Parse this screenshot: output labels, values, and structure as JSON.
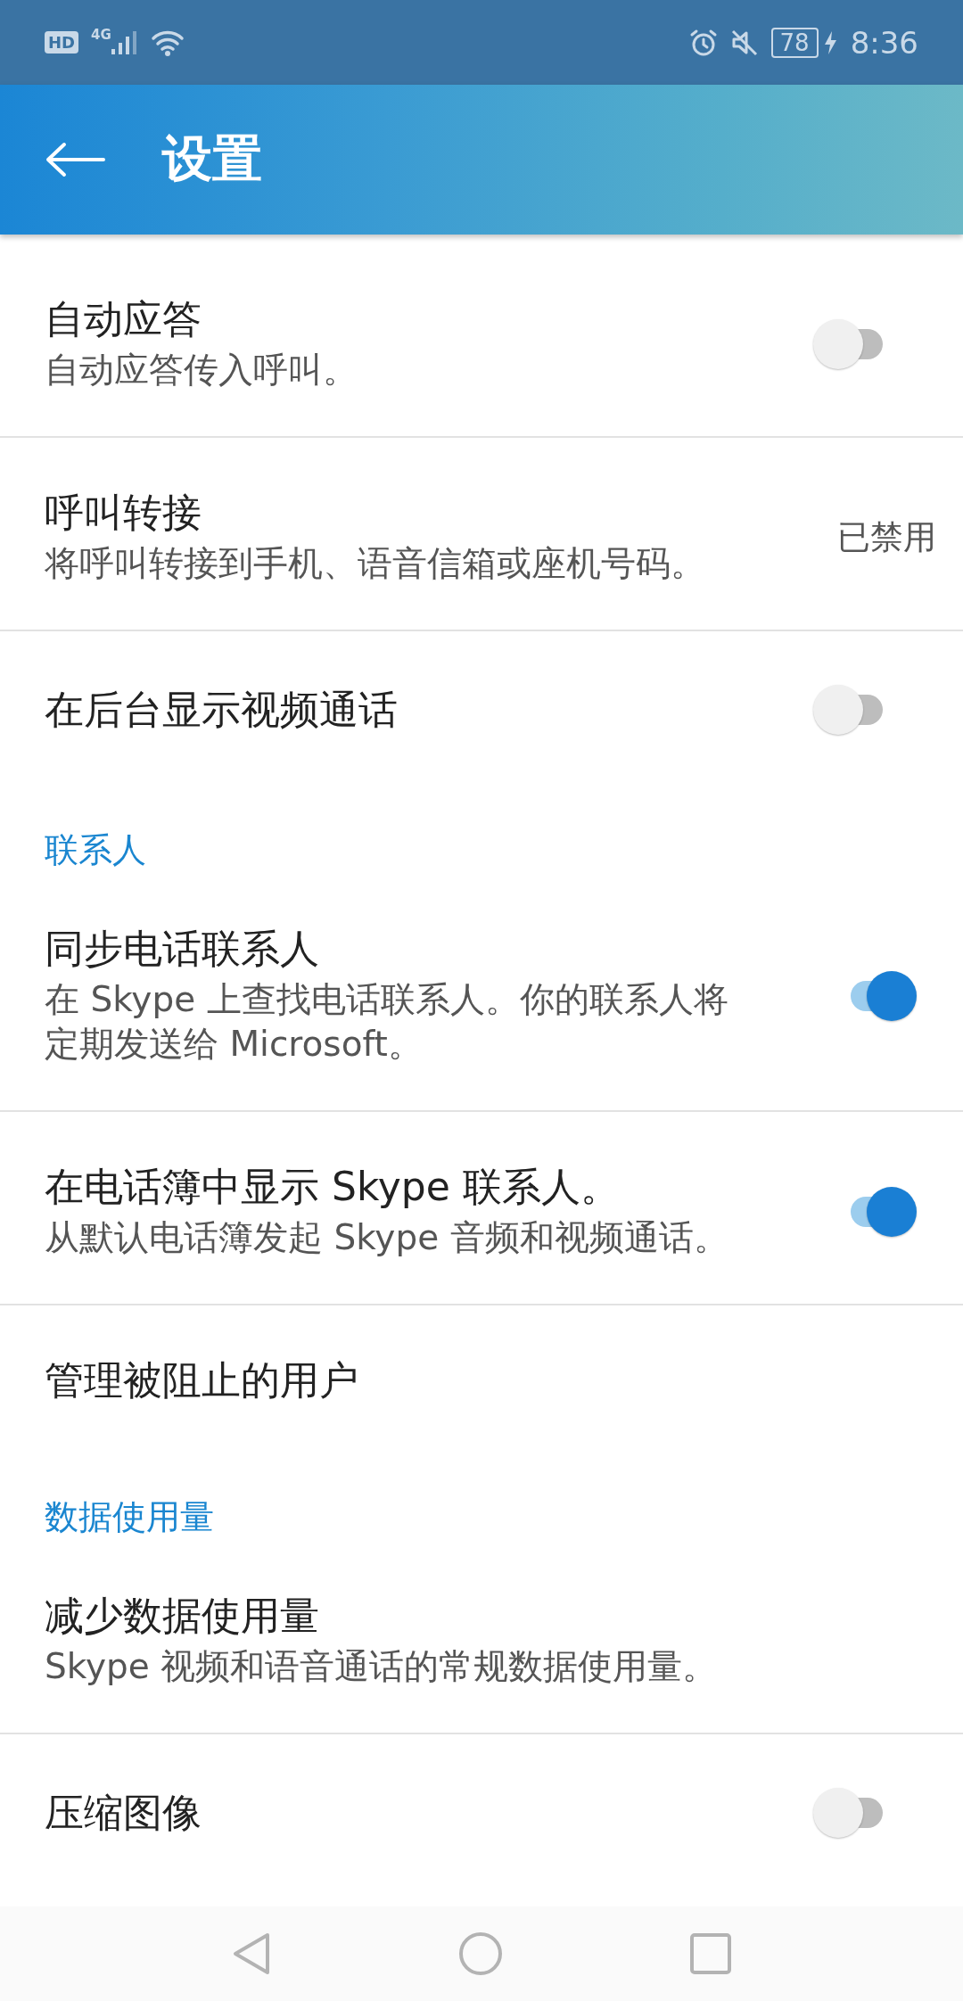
{
  "status_bar": {
    "hd": "HD",
    "network": "4G",
    "battery": "78",
    "time": "8:36"
  },
  "header": {
    "title": "设置"
  },
  "items": [
    {
      "kind": "toggle",
      "title": "自动应答",
      "subtitle": "自动应答传入呼叫。",
      "on": false
    },
    {
      "kind": "value",
      "title": "呼叫转接",
      "subtitle": "将呼叫转接到手机、语音信箱或座机号码。",
      "value": "已禁用"
    },
    {
      "kind": "toggle",
      "title": "在后台显示视频通话",
      "on": false
    },
    {
      "kind": "heading",
      "title": "联系人"
    },
    {
      "kind": "toggle",
      "title": "同步电话联系人",
      "subtitle": "在 Skype 上查找电话联系人。你的联系人将定期发送给 Microsoft。",
      "on": true
    },
    {
      "kind": "toggle",
      "title": "在电话簿中显示 Skype 联系人。",
      "subtitle": "从默认电话簿发起 Skype 音频和视频通话。",
      "on": true
    },
    {
      "kind": "plain",
      "title": "管理被阻止的用户"
    },
    {
      "kind": "heading",
      "title": "数据使用量"
    },
    {
      "kind": "plain",
      "title": "减少数据使用量",
      "subtitle": "Skype 视频和语音通话的常规数据使用量。"
    },
    {
      "kind": "toggle",
      "title": "压缩图像",
      "on": false
    }
  ]
}
